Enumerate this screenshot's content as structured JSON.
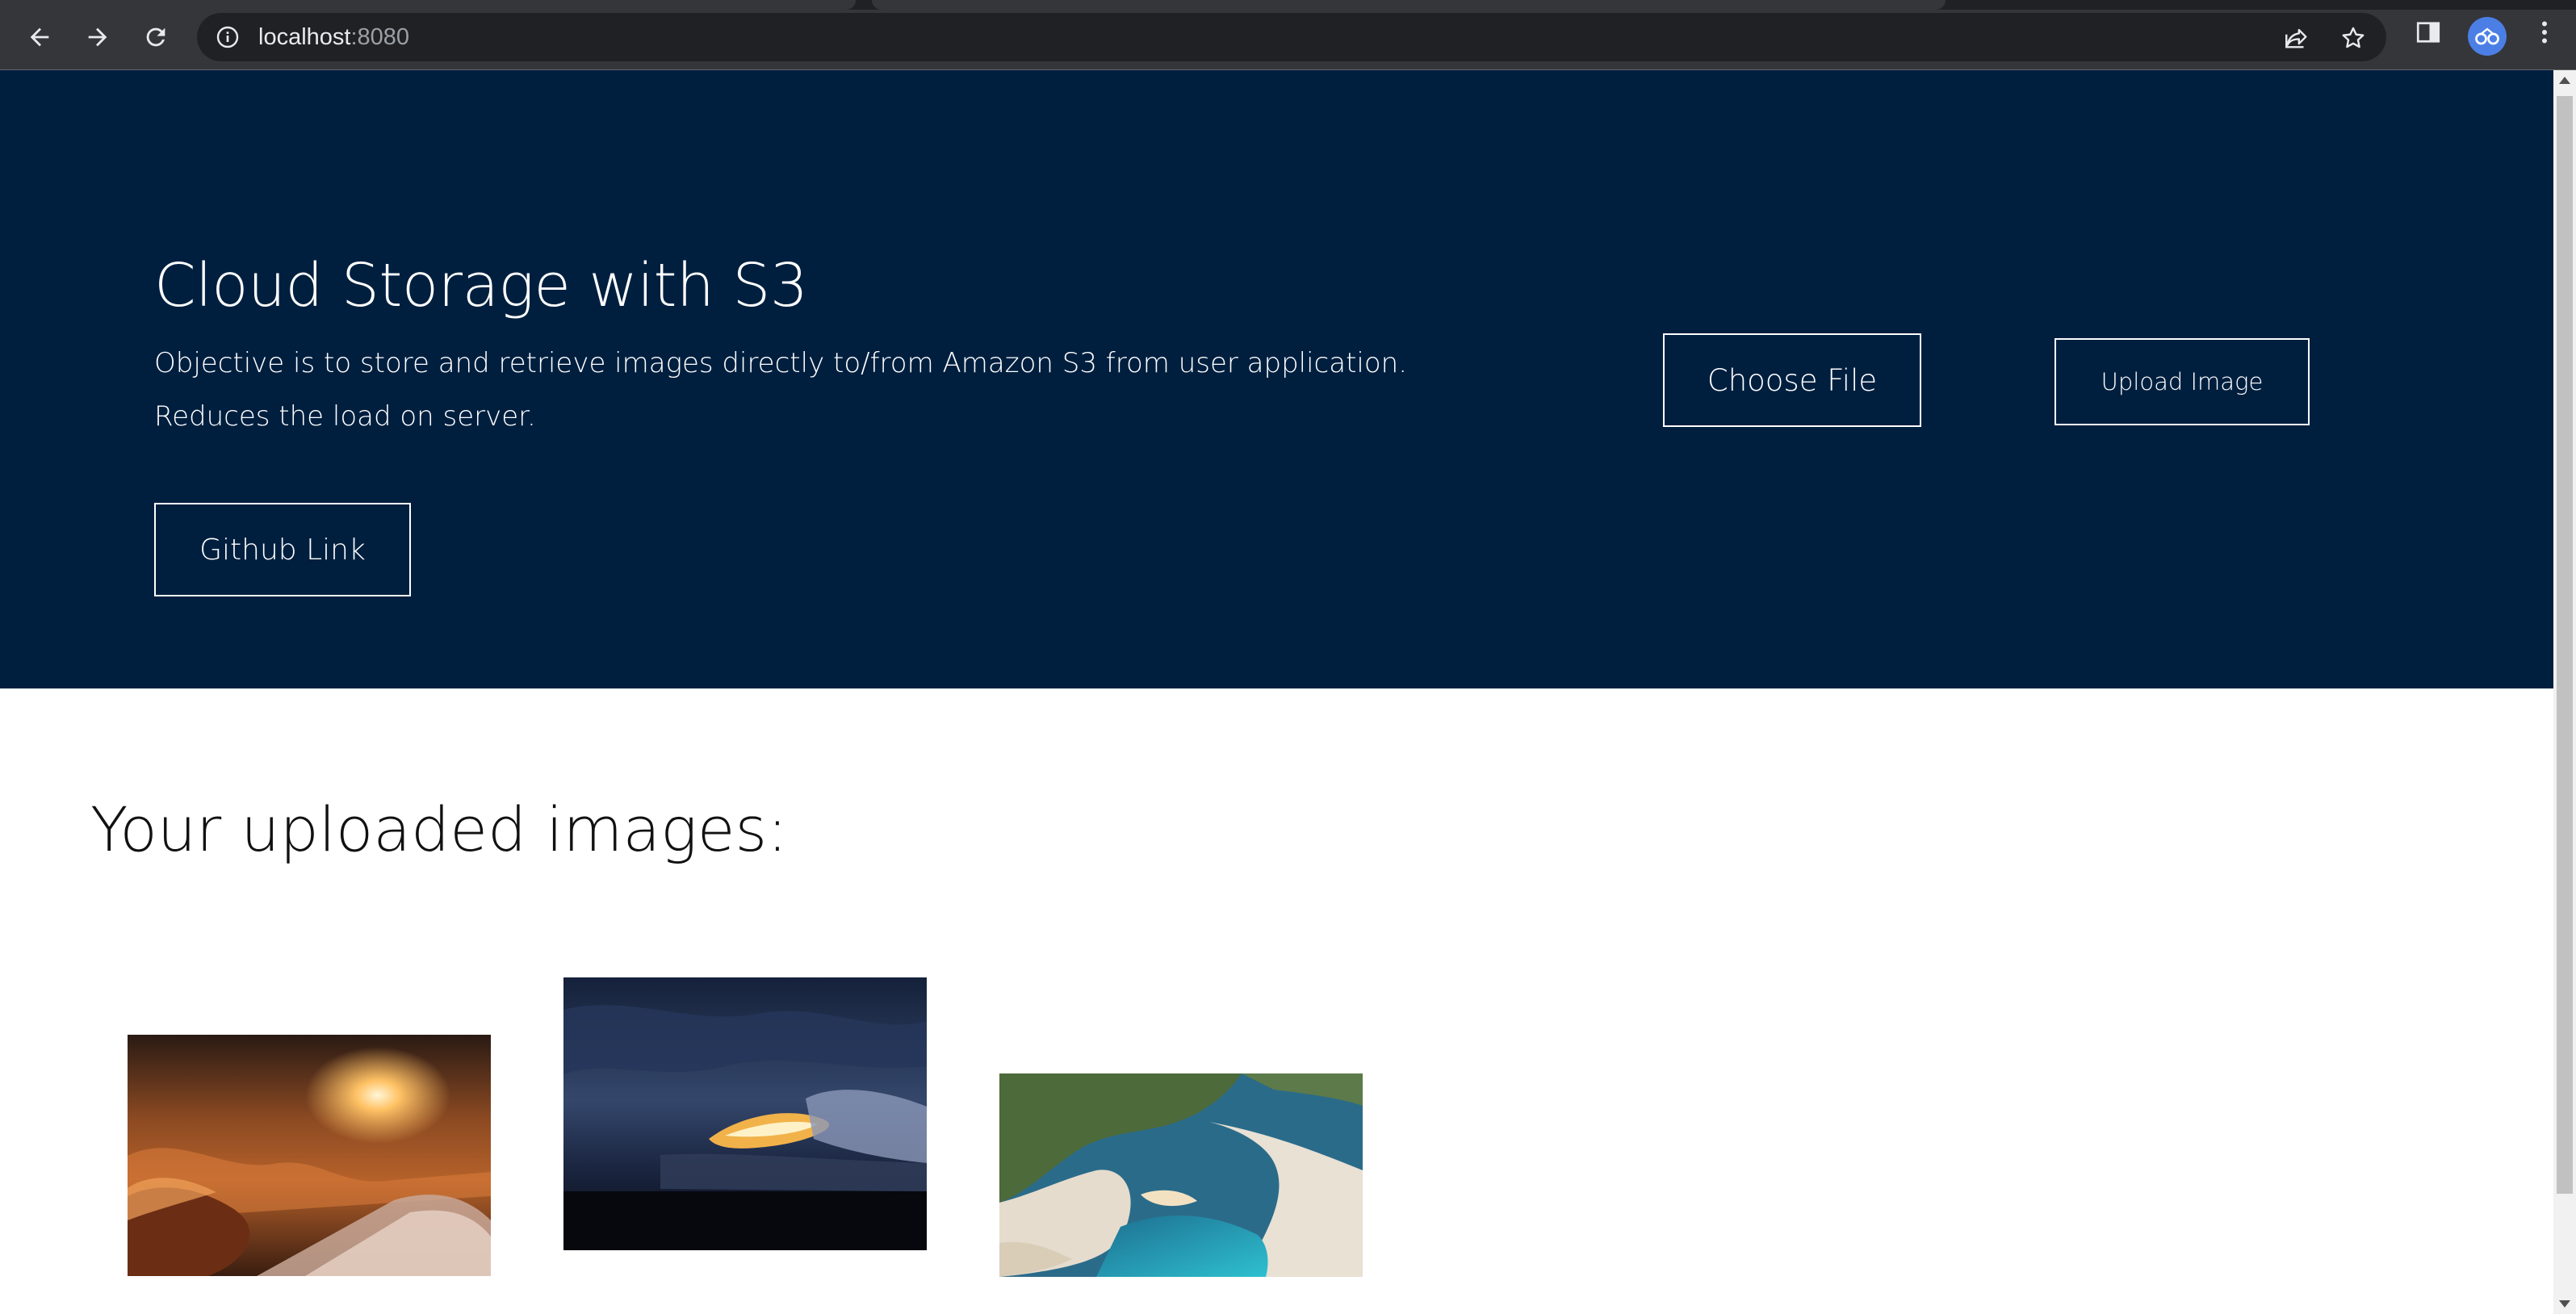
{
  "browser": {
    "url_host": "localhost",
    "url_port": ":8080",
    "icons": [
      "back-arrow-icon",
      "forward-arrow-icon",
      "reload-icon",
      "info-icon",
      "share-icon",
      "star-icon",
      "side-panel-icon",
      "profile-avatar",
      "more-menu-icon"
    ]
  },
  "hero": {
    "title": "Cloud Storage with S3",
    "description_line1": "Objective is to store and retrieve images directly to/from Amazon S3 from user application.",
    "description_line2": "Reduces the load on server.",
    "github_button": "Github Link",
    "choose_file_button": "Choose File",
    "upload_button": "Upload Image",
    "background_color": "#001f3f"
  },
  "gallery": {
    "title": "Your uploaded images:",
    "images": [
      {
        "subject": "sunset over clouds",
        "colors": [
          "#7a3a16",
          "#f2a04a"
        ]
      },
      {
        "subject": "dusk sky over sea",
        "colors": [
          "#1b2940",
          "#f0b050"
        ]
      },
      {
        "subject": "shipwreck cove cliffs",
        "colors": [
          "#2ab3c4",
          "#e7dccb"
        ]
      }
    ]
  }
}
